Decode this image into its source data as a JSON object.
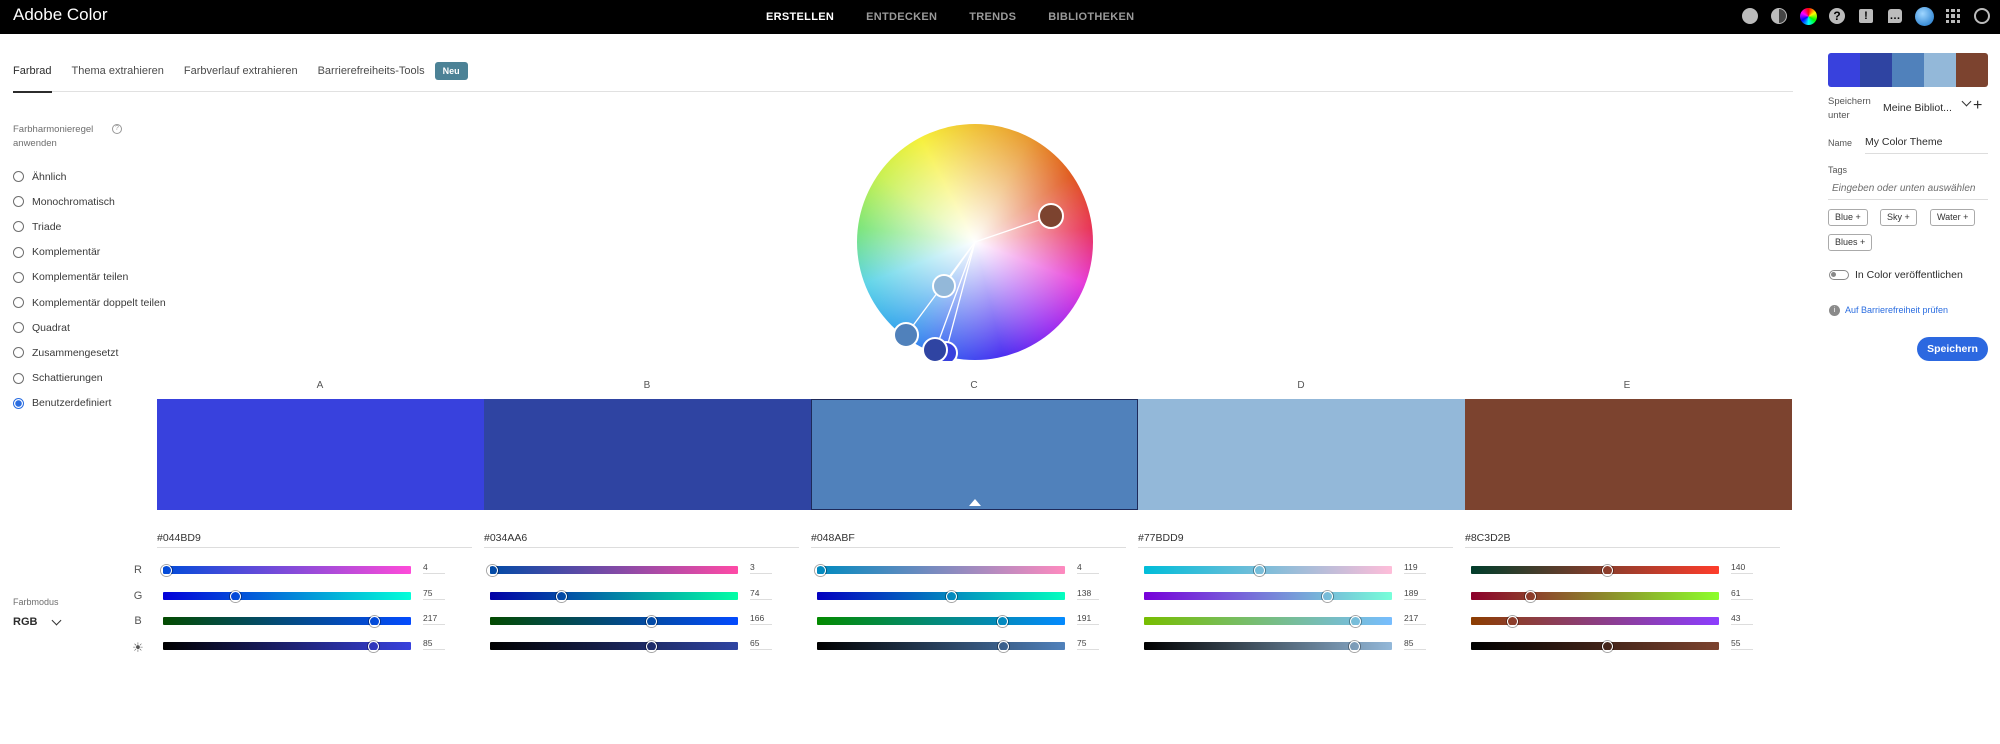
{
  "app": {
    "title": "Adobe Color"
  },
  "topnav": [
    {
      "label": "ERSTELLEN",
      "active": true
    },
    {
      "label": "ENTDECKEN",
      "active": false
    },
    {
      "label": "TRENDS",
      "active": false
    },
    {
      "label": "BIBLIOTHEKEN",
      "active": false
    }
  ],
  "top_icons": [
    "star-icon",
    "contrast-icon",
    "color-wheel-icon",
    "help-icon",
    "alert-icon",
    "chat-icon",
    "avatar",
    "apps-grid-icon",
    "creative-cloud-icon"
  ],
  "tabs": [
    {
      "label": "Farbrad",
      "active": true
    },
    {
      "label": "Thema extrahieren",
      "active": false
    },
    {
      "label": "Farbverlauf extrahieren",
      "active": false
    },
    {
      "label": "Barrierefreiheits-Tools",
      "active": false
    }
  ],
  "tab_badge": "Neu",
  "harmony": {
    "title": "Farbharmonieregel anwenden",
    "rules": [
      {
        "label": "Ähnlich",
        "selected": false
      },
      {
        "label": "Monochromatisch",
        "selected": false
      },
      {
        "label": "Triade",
        "selected": false
      },
      {
        "label": "Komplementär",
        "selected": false
      },
      {
        "label": "Komplementär teilen",
        "selected": false
      },
      {
        "label": "Komplementär doppelt teilen",
        "selected": false
      },
      {
        "label": "Quadrat",
        "selected": false
      },
      {
        "label": "Zusammengesetzt",
        "selected": false
      },
      {
        "label": "Schattierungen",
        "selected": false
      },
      {
        "label": "Benutzerdefiniert",
        "selected": true
      }
    ]
  },
  "color_mode": {
    "label": "Farbmodus",
    "value": "RGB"
  },
  "channel_labels": [
    "R",
    "G",
    "B"
  ],
  "swatches": [
    {
      "letter": "A",
      "hex": "#044BD9",
      "color": "#3841dd",
      "r": "4",
      "g": "75",
      "b": "217",
      "bright": "85",
      "selected": false
    },
    {
      "letter": "B",
      "hex": "#034AA6",
      "color": "#2f44a2",
      "r": "3",
      "g": "74",
      "b": "166",
      "bright": "65",
      "selected": false
    },
    {
      "letter": "C",
      "hex": "#048ABF",
      "color": "#5081bb",
      "r": "4",
      "g": "138",
      "b": "191",
      "bright": "75",
      "selected": true
    },
    {
      "letter": "D",
      "hex": "#77BDD9",
      "color": "#93b8d9",
      "r": "119",
      "g": "189",
      "b": "217",
      "bright": "85",
      "selected": false
    },
    {
      "letter": "E",
      "hex": "#8C3D2B",
      "color": "#7c432f",
      "r": "140",
      "g": "61",
      "b": "43",
      "bright": "55",
      "selected": false
    }
  ],
  "right_panel": {
    "save_under_label": "Speichern unter",
    "library": "Meine Bibliot...",
    "name_label": "Name",
    "name_value": "My Color Theme",
    "tags_label": "Tags",
    "tags_placeholder": "Eingeben oder unten auswählen",
    "tags": [
      "Blue",
      "Sky",
      "Water",
      "Blues"
    ],
    "publish_label": "In Color veröffentlichen",
    "publish_on": false,
    "accessibility_link": "Auf Barrierefreiheit prüfen",
    "save_button": "Speichern"
  }
}
